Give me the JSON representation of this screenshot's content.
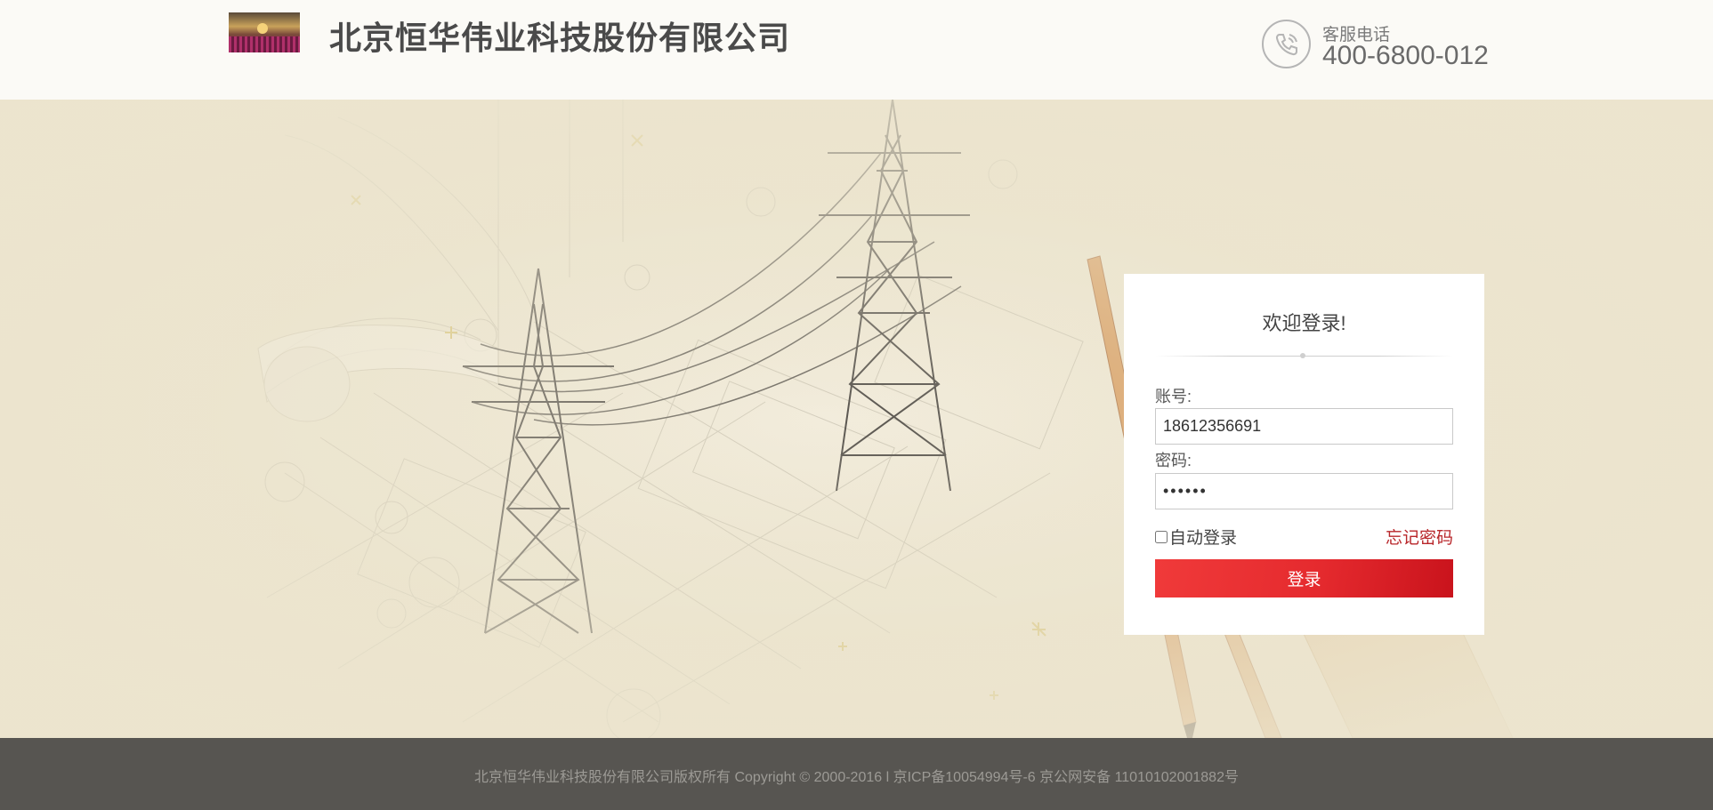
{
  "header": {
    "company_name": "北京恒华伟业科技股份有限公司",
    "logo_icon": "company-logo-sunset-flowers",
    "service_label": "客服电话",
    "service_phone": "400-6800-012",
    "phone_icon": "phone-icon"
  },
  "login": {
    "title": "欢迎登录!",
    "account_label": "账号:",
    "account_value": "18612356691",
    "password_label": "密码:",
    "password_value": "••••••",
    "remember_label": "自动登录",
    "remember_checked": false,
    "forgot_label": "忘记密码",
    "submit_label": "登录"
  },
  "footer": {
    "copyright": "北京恒华伟业科技股份有限公司版权所有 Copyright © 2000-2016 l 京ICP备10054994号-6 京公网安备 11010102001882号"
  },
  "colors": {
    "accent": "#e52a2e",
    "forgot_link": "#b8262a",
    "footer_bg": "#575551",
    "hero_bg": "#ece5cf"
  }
}
